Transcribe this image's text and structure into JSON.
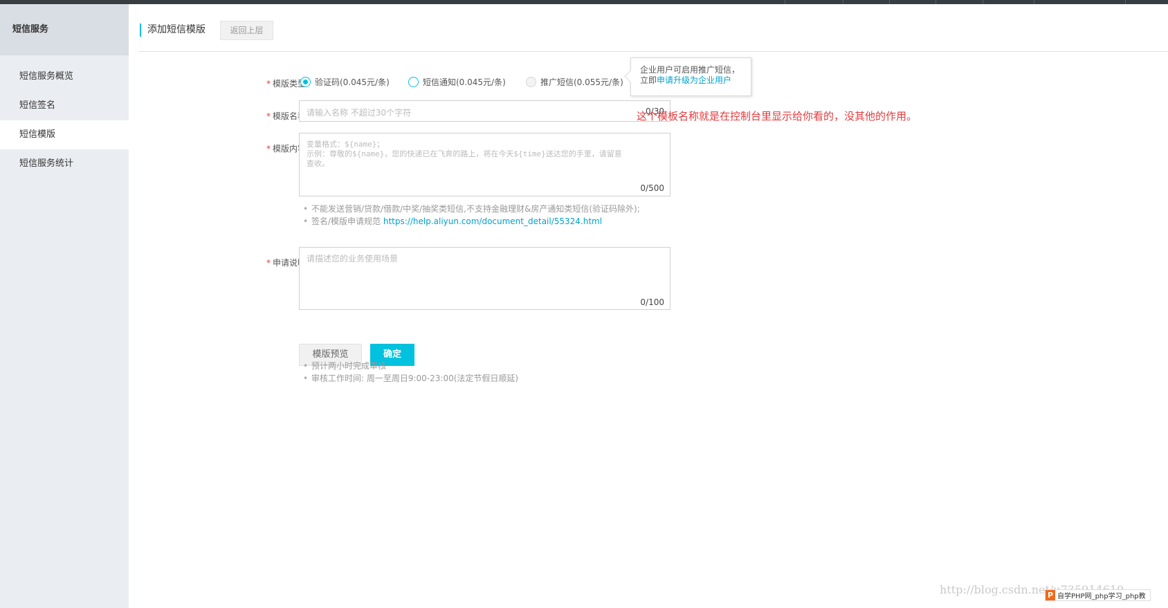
{
  "sidebar": {
    "title": "短信服务",
    "items": [
      {
        "label": "短信服务概览"
      },
      {
        "label": "短信签名"
      },
      {
        "label": "短信模版"
      },
      {
        "label": "短信服务统计"
      }
    ]
  },
  "header": {
    "title": "添加短信模版",
    "back_label": "返回上层"
  },
  "form": {
    "type": {
      "label": "模版类型:",
      "options": [
        {
          "label": "验证码(0.045元/条)",
          "state": "checked"
        },
        {
          "label": "短信通知(0.045元/条)",
          "state": "unchecked"
        },
        {
          "label": "推广短信(0.055元/条)",
          "state": "disabled"
        }
      ],
      "tooltip_line1": "企业用户可启用推广短信，",
      "tooltip_prefix": "立即",
      "tooltip_link": "申请升级为企业用户"
    },
    "name": {
      "label": "模版名称:",
      "placeholder": "请输入名称 不超过30个字符",
      "counter": "0/30"
    },
    "content": {
      "label": "模版内容:",
      "placeholder_line1": "变量格式：${name}；",
      "placeholder_line2": " 示例：尊敬的${name}，您的快递已在飞奔的路上，将在今天${time}送达您的手里，请留意",
      "placeholder_line3": "查收。",
      "counter": "0/500",
      "tips": [
        "不能发送营销/贷款/借款/中奖/抽奖类短信,不支持金融理财&房产通知类短信(验证码除外);"
      ],
      "tip2_prefix": "签名/模版申请规范 ",
      "tip2_link": "https://help.aliyun.com/document_detail/55324.html"
    },
    "description": {
      "label": "申请说明:",
      "placeholder": "请描述您的业务使用场景",
      "counter": "0/100"
    },
    "buttons": {
      "preview": "模版预览",
      "confirm": "确定"
    },
    "footer_tips": [
      "预计两小时完成审核",
      "审核工作时间: 周一至周日9:00-23:00(法定节假日顺延)"
    ]
  },
  "annotation": "这个模板名称就是在控制台里显示给你看的，没其他的作用。",
  "watermark": {
    "url": "http://blog.csdn.net/u735914610",
    "badge_logo": "P",
    "badge_text": "自学PHP网_php学习_php教"
  },
  "colors": {
    "accent": "#00c1de",
    "required": "#e4393c",
    "link": "#00a2ca",
    "sidebar_bg": "#eaedf1",
    "topbar": "#373d41"
  }
}
